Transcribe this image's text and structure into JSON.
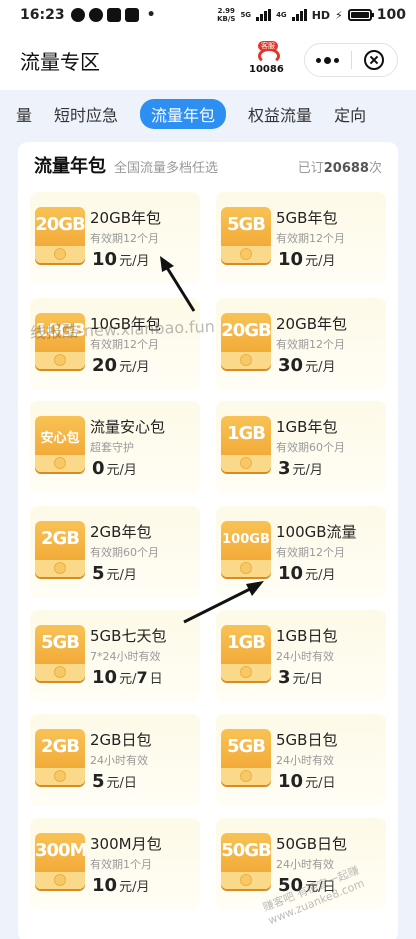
{
  "status_bar": {
    "time": "16:23",
    "dot": "•",
    "net_speed_value": "2.99",
    "net_speed_unit": "KB/S",
    "net1": "5G",
    "net2": "4G",
    "hd": "HD",
    "battery": "100"
  },
  "nav": {
    "title": "流量专区",
    "logo_badge": "客服",
    "logo_text": "10086"
  },
  "tabs": [
    {
      "label": "量",
      "active": false
    },
    {
      "label": "短时应急",
      "active": false
    },
    {
      "label": "流量年包",
      "active": true
    },
    {
      "label": "权益流量",
      "active": false
    },
    {
      "label": "定向",
      "active": false
    }
  ],
  "panel": {
    "title": "流量年包",
    "subtitle": "全国流量多档任选",
    "count_prefix": "已订",
    "count_value": "20688",
    "count_suffix": "次"
  },
  "products": [
    {
      "badge": "20GB",
      "title": "20GB年包",
      "desc": "有效期12个月",
      "price": "10",
      "unit": "元/月"
    },
    {
      "badge": "5GB",
      "title": "5GB年包",
      "desc": "有效期12个月",
      "price": "10",
      "unit": "元/月"
    },
    {
      "badge": "10GB",
      "title": "10GB年包",
      "desc": "有效期12个月",
      "price": "20",
      "unit": "元/月"
    },
    {
      "badge": "20GB",
      "title": "20GB年包",
      "desc": "有效期12个月",
      "price": "30",
      "unit": "元/月"
    },
    {
      "badge": "安心包",
      "title": "流量安心包",
      "desc": "超套守护",
      "price": "0",
      "unit": "元/月"
    },
    {
      "badge": "1GB",
      "title": "1GB年包",
      "desc": "有效期60个月",
      "price": "3",
      "unit": "元/月"
    },
    {
      "badge": "2GB",
      "title": "2GB年包",
      "desc": "有效期60个月",
      "price": "5",
      "unit": "元/月"
    },
    {
      "badge": "100GB",
      "title": "100GB流量",
      "desc": "有效期12个月",
      "price": "10",
      "unit": "元/月"
    },
    {
      "badge": "5GB",
      "title": "5GB七天包",
      "desc": "7*24小时有效",
      "price": "10",
      "unit": "元/",
      "price2": "7",
      "unit2": "日"
    },
    {
      "badge": "1GB",
      "title": "1GB日包",
      "desc": "24小时有效",
      "price": "3",
      "unit": "元/日"
    },
    {
      "badge": "2GB",
      "title": "2GB日包",
      "desc": "24小时有效",
      "price": "5",
      "unit": "元/日"
    },
    {
      "badge": "5GB",
      "title": "5GB日包",
      "desc": "24小时有效",
      "price": "10",
      "unit": "元/日"
    },
    {
      "badge": "300M",
      "title": "300M月包",
      "desc": "有效期1个月",
      "price": "10",
      "unit": "元/月"
    },
    {
      "badge": "50GB",
      "title": "50GB日包",
      "desc": "24小时有效",
      "price": "50",
      "unit": "元/日"
    }
  ],
  "watermark": "线报酷-new.xianbao.fun",
  "watermark2": "赚客吧 有便宜一起赚 www.zuanke8.com",
  "colors": {
    "accent": "#2e8ff2",
    "badge": "#f0a12d",
    "card_bg": "#fefae8",
    "page_bg": "#eef3fb"
  }
}
